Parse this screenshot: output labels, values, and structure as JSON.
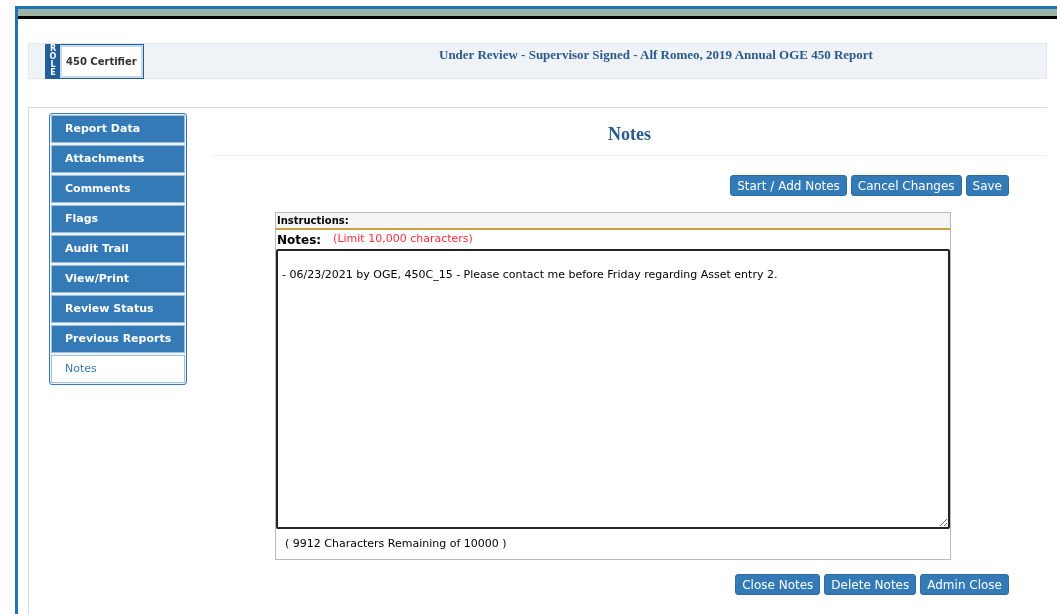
{
  "role_badge": {
    "tag": "ROLE",
    "label": "450 Certifier"
  },
  "report_title": "Under Review - Supervisor Signed - Alf Romeo, 2019 Annual OGE 450 Report",
  "sidebar": {
    "items": [
      {
        "label": "Report Data",
        "selected": false
      },
      {
        "label": "Attachments",
        "selected": false
      },
      {
        "label": "Comments",
        "selected": false
      },
      {
        "label": "Flags",
        "selected": false
      },
      {
        "label": "Audit Trail",
        "selected": false
      },
      {
        "label": "View/Print",
        "selected": false
      },
      {
        "label": "Review Status",
        "selected": false
      },
      {
        "label": "Previous Reports",
        "selected": false
      },
      {
        "label": "Notes",
        "selected": true
      }
    ]
  },
  "page_title": "Notes",
  "top_buttons": [
    "Start / Add Notes",
    "Cancel Changes",
    "Save"
  ],
  "notes": {
    "instructions_label": "Instructions:",
    "notes_label": "Notes:",
    "limit": "(Limit 10,000 characters)",
    "value": "- 06/23/2021 by OGE, 450C_15 - Please contact me before Friday regarding Asset entry 2.",
    "remaining": "( 9912 Characters Remaining of 10000 )"
  },
  "bottom_buttons": [
    "Close Notes",
    "Delete Notes",
    "Admin Close"
  ]
}
